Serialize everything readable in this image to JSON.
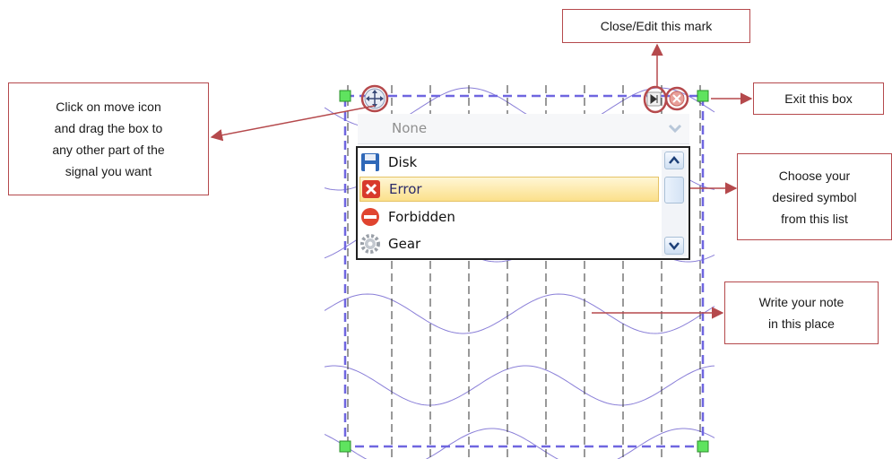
{
  "callouts": {
    "move": [
      "Click on move icon",
      "and drag the box to",
      "any other part of the",
      "signal you want"
    ],
    "close_edit": [
      "Close/Edit this mark"
    ],
    "exit": [
      "Exit this box"
    ],
    "symbol": [
      "Choose your",
      "desired symbol",
      "from this list"
    ],
    "note": [
      "Write your note",
      "in this place"
    ]
  },
  "dropdown": {
    "value": "None"
  },
  "symbol_list": {
    "items": [
      {
        "label": "Disk",
        "icon": "disk-icon"
      },
      {
        "label": "Error",
        "icon": "error-icon",
        "selected": true
      },
      {
        "label": "Forbidden",
        "icon": "forbidden-icon"
      },
      {
        "label": "Gear",
        "icon": "gear-icon"
      }
    ]
  },
  "colors": {
    "callout_border": "#b5494c",
    "arrow": "#b5494c",
    "box_border": "#6f66e0",
    "handle_fill": "#5fe35f",
    "waveform": "#8a7fd8",
    "gridline": "#333333",
    "selection": "#fbe08b"
  }
}
